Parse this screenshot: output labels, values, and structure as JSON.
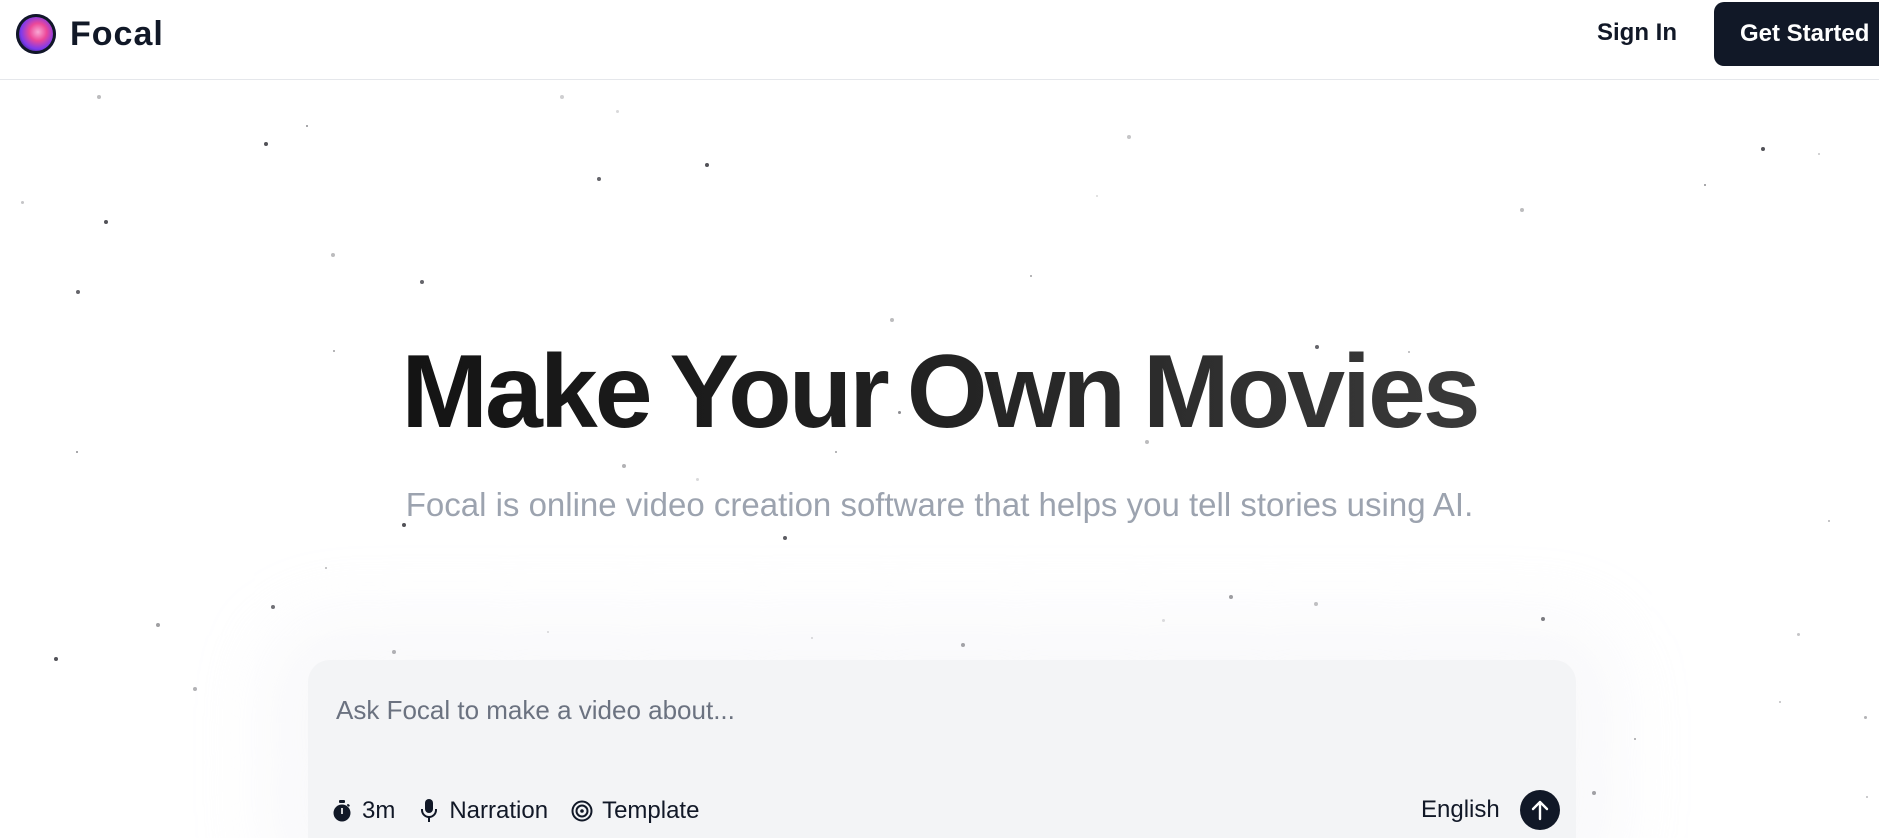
{
  "header": {
    "brand": "Focal",
    "sign_in": "Sign In",
    "get_started": "Get Started"
  },
  "hero": {
    "title_words": [
      "Make",
      "Your",
      "Own",
      "Movies"
    ],
    "subtitle": "Focal is online video creation software that helps you tell stories using AI."
  },
  "prompt": {
    "placeholder": "Ask Focal to make a video about...",
    "options": [
      {
        "icon": "stopwatch-icon",
        "label": "3m"
      },
      {
        "icon": "microphone-icon",
        "label": "Narration"
      },
      {
        "icon": "target-icon",
        "label": "Template"
      }
    ],
    "language": "English",
    "send_icon": "arrow-up-icon"
  },
  "colors": {
    "primary": "#111827",
    "subtitle": "#9ca3af",
    "prompt_bg": "#f3f4f6"
  }
}
